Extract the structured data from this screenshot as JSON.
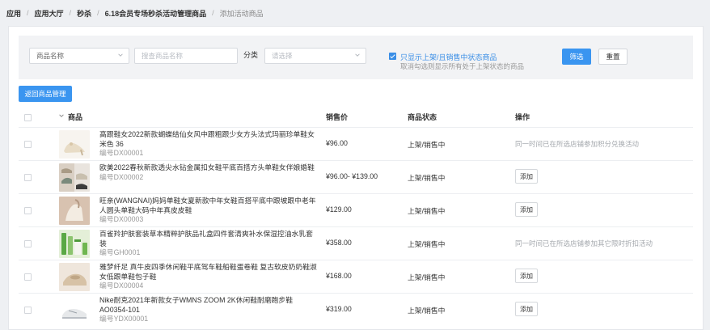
{
  "breadcrumb": [
    {
      "label": "应用"
    },
    {
      "label": "应用大厅"
    },
    {
      "label": "秒杀"
    },
    {
      "label": "6.18会员专场秒杀活动管理商品"
    },
    {
      "label": "添加活动商品"
    }
  ],
  "filter": {
    "field_select": "商品名称",
    "search_placeholder": "搜查商品名称",
    "category_label": "分类",
    "category_placeholder": "请选择",
    "only_onsale_label": "只显示上架/且销售中状态商品",
    "only_onsale_checked": true,
    "only_onsale_hint": "取消勾选则显示所有处于上架状态的商品",
    "filter_button": "筛选",
    "reset_button": "重置"
  },
  "back_button": "返回商品管理",
  "table": {
    "columns": {
      "product": "商品",
      "price": "销售价",
      "status": "商品状态",
      "action": "操作"
    },
    "rows": [
      {
        "name": "高跟鞋女2022新款蝴蝶结仙女风中跟粗跟少女方头法式玛丽珍单鞋女 米色 36",
        "code": "编号DX00001",
        "price": "¥96.00",
        "status": "上架/销售中",
        "action_type": "note",
        "action": "同一时间已在所选店铺参加积分兑换活动",
        "thumb_icon": "shoe-beige-icon"
      },
      {
        "name": "欧美2022春秋新款透尖水钻金属扣女鞋平底百搭方头单鞋女伴娘婚鞋",
        "code": "编号DX00002",
        "price": "¥96.00- ¥139.00",
        "status": "上架/销售中",
        "action_type": "button",
        "action": "添加",
        "thumb_icon": "shoe-collage-icon"
      },
      {
        "name": "旺亲(WANGNAI)妈妈单鞋女夏新款中年女鞋百搭平底中跟坡跟中老年人圆头单鞋大码中年真皮皮鞋",
        "code": "编号DX00003",
        "price": "¥129.00",
        "status": "上架/销售中",
        "action_type": "button",
        "action": "添加",
        "thumb_icon": "shoe-cream-icon"
      },
      {
        "name": "百雀羚护肤套装草本精粹护肤品礼盒四件套清爽补水保湿控油水乳套装",
        "code": "编号GH0001",
        "price": "¥358.00",
        "status": "上架/销售中",
        "action_type": "note",
        "action": "同一时间已在所选店铺参加其它限时折扣活动",
        "thumb_icon": "skincare-set-icon"
      },
      {
        "name": "雅梦纤足 真牛皮四季休闲鞋平底驾车鞋船鞋蛋卷鞋 复古软皮奶奶鞋淑女低跟单鞋包子鞋",
        "code": "编号DX00004",
        "price": "¥168.00",
        "status": "上架/销售中",
        "action_type": "button",
        "action": "添加",
        "thumb_icon": "shoe-beige2-icon"
      },
      {
        "name": "Nike耐克2021年新款女子WMNS ZOOM 2K休闲鞋耐磨跑步鞋AO0354-101",
        "code": "编号YDX00001",
        "price": "¥319.00",
        "status": "上架/销售中",
        "action_type": "button",
        "action": "添加",
        "thumb_icon": "sneaker-icon"
      }
    ]
  },
  "colors": {
    "accent": "#3a95f0",
    "link_blue": "#3a8ee6",
    "muted": "#999999"
  }
}
